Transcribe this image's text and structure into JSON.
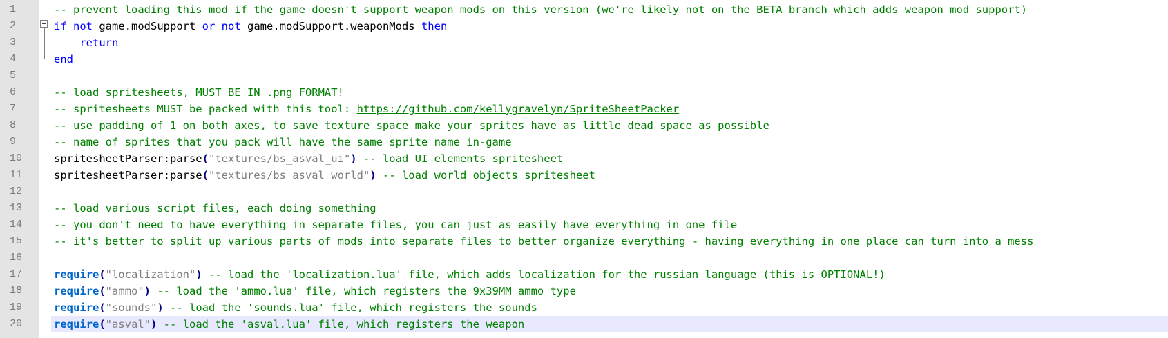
{
  "editor": {
    "current_line": 20,
    "lines": [
      {
        "n": "1",
        "tokens": [
          {
            "t": "-- prevent loading this mod if the game doesn't support weapon mods on this version (we're likely not on the BETA branch which adds weapon mod support)",
            "c": "comment"
          }
        ]
      },
      {
        "n": "2",
        "tokens": [
          {
            "t": "if",
            "c": "kw"
          },
          {
            "t": " ",
            "c": "id"
          },
          {
            "t": "not",
            "c": "kw"
          },
          {
            "t": " game.modSupport ",
            "c": "id"
          },
          {
            "t": "or",
            "c": "kw"
          },
          {
            "t": " ",
            "c": "id"
          },
          {
            "t": "not",
            "c": "kw"
          },
          {
            "t": " game.modSupport.weaponMods ",
            "c": "id"
          },
          {
            "t": "then",
            "c": "kw"
          }
        ]
      },
      {
        "n": "3",
        "tokens": [
          {
            "t": "    ",
            "c": "id"
          },
          {
            "t": "return",
            "c": "kw"
          }
        ]
      },
      {
        "n": "4",
        "tokens": [
          {
            "t": "end",
            "c": "kw"
          }
        ]
      },
      {
        "n": "5",
        "tokens": []
      },
      {
        "n": "6",
        "tokens": [
          {
            "t": "-- load spritesheets, MUST BE IN .png FORMAT!",
            "c": "comment"
          }
        ]
      },
      {
        "n": "7",
        "tokens": [
          {
            "t": "-- spritesheets MUST be packed with this tool: ",
            "c": "comment"
          },
          {
            "t": "https://github.com/kellygravelyn/SpriteSheetPacker",
            "c": "link"
          }
        ]
      },
      {
        "n": "8",
        "tokens": [
          {
            "t": "-- use padding of 1 on both axes, to save texture space make your sprites have as little dead space as possible",
            "c": "comment"
          }
        ]
      },
      {
        "n": "9",
        "tokens": [
          {
            "t": "-- name of sprites that you pack will have the same sprite name in-game",
            "c": "comment"
          }
        ]
      },
      {
        "n": "10",
        "tokens": [
          {
            "t": "spritesheetParser:parse",
            "c": "id"
          },
          {
            "t": "(",
            "c": "paren"
          },
          {
            "t": "\"textures/bs_asval_ui\"",
            "c": "str"
          },
          {
            "t": ")",
            "c": "paren"
          },
          {
            "t": " -- load UI elements spritesheet",
            "c": "comment"
          }
        ]
      },
      {
        "n": "11",
        "tokens": [
          {
            "t": "spritesheetParser:parse",
            "c": "id"
          },
          {
            "t": "(",
            "c": "paren"
          },
          {
            "t": "\"textures/bs_asval_world\"",
            "c": "str"
          },
          {
            "t": ")",
            "c": "paren"
          },
          {
            "t": " -- load world objects spritesheet",
            "c": "comment"
          }
        ]
      },
      {
        "n": "12",
        "tokens": []
      },
      {
        "n": "13",
        "tokens": [
          {
            "t": "-- load various script files, each doing something",
            "c": "comment"
          }
        ]
      },
      {
        "n": "14",
        "tokens": [
          {
            "t": "-- you don't need to have everything in separate files, you can just as easily have everything in one file",
            "c": "comment"
          }
        ]
      },
      {
        "n": "15",
        "tokens": [
          {
            "t": "-- it's better to split up various parts of mods into separate files to better organize everything - having everything in one place can turn into a mess",
            "c": "comment"
          }
        ]
      },
      {
        "n": "16",
        "tokens": []
      },
      {
        "n": "17",
        "tokens": [
          {
            "t": "require",
            "c": "fn"
          },
          {
            "t": "(",
            "c": "paren"
          },
          {
            "t": "\"localization\"",
            "c": "str"
          },
          {
            "t": ")",
            "c": "paren"
          },
          {
            "t": " -- load the 'localization.lua' file, which adds localization for the russian language (this is OPTIONAL!)",
            "c": "comment"
          }
        ]
      },
      {
        "n": "18",
        "tokens": [
          {
            "t": "require",
            "c": "fn"
          },
          {
            "t": "(",
            "c": "paren"
          },
          {
            "t": "\"ammo\"",
            "c": "str"
          },
          {
            "t": ")",
            "c": "paren"
          },
          {
            "t": " -- load the 'ammo.lua' file, which registers the 9x39MM ammo type",
            "c": "comment"
          }
        ]
      },
      {
        "n": "19",
        "tokens": [
          {
            "t": "require",
            "c": "fn"
          },
          {
            "t": "(",
            "c": "paren"
          },
          {
            "t": "\"sounds\"",
            "c": "str"
          },
          {
            "t": ")",
            "c": "paren"
          },
          {
            "t": " -- load the 'sounds.lua' file, which registers the sounds",
            "c": "comment"
          }
        ]
      },
      {
        "n": "20",
        "tokens": [
          {
            "t": "require",
            "c": "fn"
          },
          {
            "t": "(",
            "c": "paren"
          },
          {
            "t": "\"asval\"",
            "c": "str"
          },
          {
            "t": ")",
            "c": "paren"
          },
          {
            "t": " -- load the 'asval.lua' file, which registers the weapon",
            "c": "comment"
          }
        ]
      }
    ]
  }
}
